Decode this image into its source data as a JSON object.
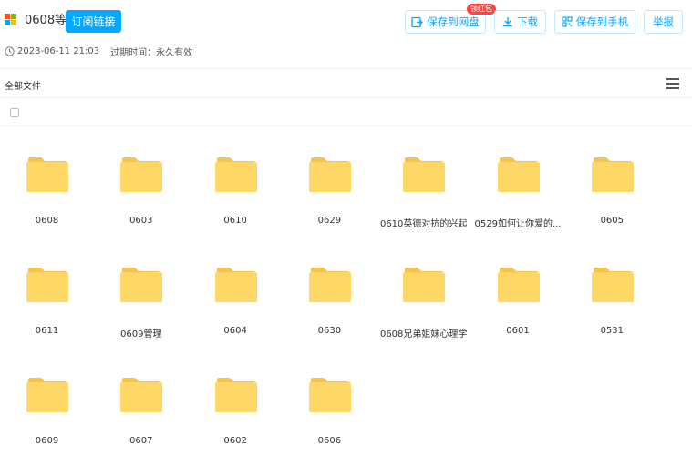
{
  "header": {
    "title": "0608等",
    "subscribe_label": "订阅链接",
    "save_netdisk_label": "保存到网盘",
    "promo_badge": "领红包",
    "download_label": "下载",
    "save_phone_label": "保存到手机",
    "report_label": "举报"
  },
  "meta": {
    "datetime": "2023-06-11 21:03",
    "expire": "过期时间：永久有效"
  },
  "breadcrumb": "全部文件",
  "colors": {
    "accent": "#06a7ff",
    "folder": "#ffd766",
    "folder_back": "#f5c44f",
    "badge": "#ff4444"
  },
  "files": [
    {
      "name": "0608"
    },
    {
      "name": "0603"
    },
    {
      "name": "0610"
    },
    {
      "name": "0629"
    },
    {
      "name": "0610英德对抗的兴起"
    },
    {
      "name": "0529如何让你爱的..."
    },
    {
      "name": "0605"
    },
    {
      "name": "0611"
    },
    {
      "name": "0609管理"
    },
    {
      "name": "0604"
    },
    {
      "name": "0630"
    },
    {
      "name": "0608兄弟姐妹心理学"
    },
    {
      "name": "0601"
    },
    {
      "name": "0531"
    },
    {
      "name": "0609"
    },
    {
      "name": "0607"
    },
    {
      "name": "0602"
    },
    {
      "name": "0606"
    }
  ]
}
